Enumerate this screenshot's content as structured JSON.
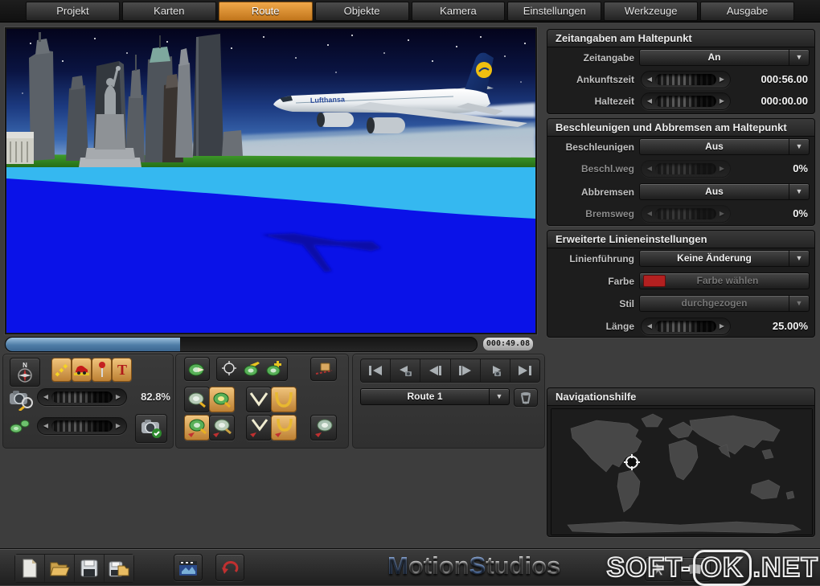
{
  "tabs": {
    "items": [
      {
        "label": "Projekt"
      },
      {
        "label": "Karten"
      },
      {
        "label": "Route",
        "active": true
      },
      {
        "label": "Objekte"
      },
      {
        "label": "Kamera"
      },
      {
        "label": "Einstellungen"
      },
      {
        "label": "Werkzeuge"
      },
      {
        "label": "Ausgabe"
      }
    ],
    "active_color": "#d9882c"
  },
  "viewport": {
    "plane_label": "Lufthansa",
    "scene": "Lufthansa airliner flying over blue water in front of New York skyline with Statue of Liberty at night"
  },
  "timeline": {
    "progress_percent": 37,
    "time_display": "000:49.08",
    "fill_color": "#5a86ae"
  },
  "left_tools": {
    "zoom_value": "82.8%"
  },
  "route_panel": {
    "selected_route": "Route 1"
  },
  "panels": {
    "time": {
      "title": "Zeitangaben am Haltepunkt",
      "zeitangabe_label": "Zeitangabe",
      "zeitangabe_value": "An",
      "ankunftszeit_label": "Ankunftszeit",
      "ankunftszeit_value": "000:56.00",
      "haltezeit_label": "Haltezeit",
      "haltezeit_value": "000:00.00"
    },
    "accel": {
      "title": "Beschleunigen und Abbremsen am Haltepunkt",
      "beschleunigen_label": "Beschleunigen",
      "beschleunigen_value": "Aus",
      "beschlweg_label": "Beschl.weg",
      "beschlweg_value": "0%",
      "abbremsen_label": "Abbremsen",
      "abbremsen_value": "Aus",
      "bremsweg_label": "Bremsweg",
      "bremsweg_value": "0%"
    },
    "line": {
      "title": "Erweiterte Linieneinstellungen",
      "linienfuehrung_label": "Linienführung",
      "linienfuehrung_value": "Keine Änderung",
      "farbe_label": "Farbe",
      "farbe_button": "Farbe wählen",
      "farbe_swatch_color": "#b32020",
      "stil_label": "Stil",
      "stil_value": "durchgezogen",
      "laenge_label": "Länge",
      "laenge_value": "25.00%"
    },
    "nav": {
      "title": "Navigationshilfe"
    }
  },
  "footer": {
    "logo": {
      "m": "M",
      "otion": "otion",
      "s": "S",
      "tudios": "tudios"
    },
    "watermark": {
      "part1": "SOFT-",
      "part2": "OK",
      "part3": ".NET"
    }
  },
  "icons": {
    "compass_n": "N",
    "dropdown_arrow": "▼",
    "slider_left": "◀",
    "slider_right": "▶"
  }
}
